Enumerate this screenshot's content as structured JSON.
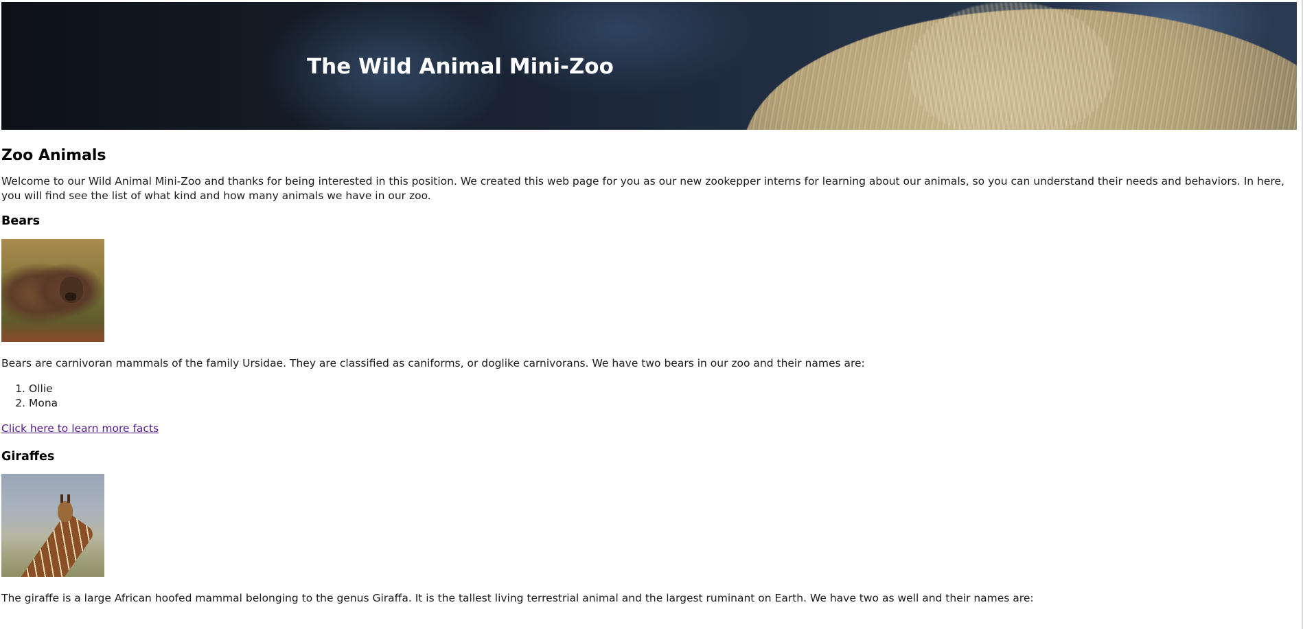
{
  "header": {
    "title": "The Wild Animal Mini-Zoo"
  },
  "main": {
    "heading": "Zoo Animals",
    "intro": "Welcome to our Wild Animal Mini-Zoo and thanks for being interested in this position. We created this web page for you as our new zookepper interns for learning about our animals, so you can understand their needs and behaviors. In here, you will find see the list of what kind and how many animals we have in our zoo.",
    "bears": {
      "heading": "Bears",
      "description": "Bears are carnivoran mammals of the family Ursidae. They are classified as caniforms, or doglike carnivorans. We have two bears in our zoo and their names are:",
      "names": [
        "Ollie",
        "Mona"
      ],
      "link_text": "Click here to learn more facts"
    },
    "giraffes": {
      "heading": "Giraffes",
      "description": "The giraffe is a large African hoofed mammal belonging to the genus Giraffa. It is the tallest living terrestrial animal and the largest ruminant on Earth. We have two as well and their names are:"
    }
  },
  "colors": {
    "link_visited": "#551a8b",
    "banner_title": "#ffffff"
  }
}
